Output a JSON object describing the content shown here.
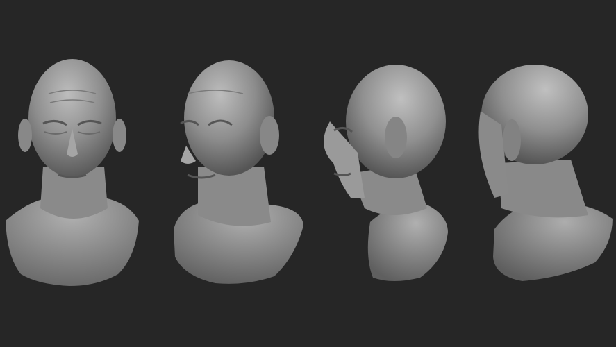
{
  "scene": {
    "background_color": "#262626",
    "material_color": "#9a9a9a",
    "views": [
      {
        "name": "front",
        "icon": "bust-front-view"
      },
      {
        "name": "three-quarter",
        "icon": "bust-three-quarter-view"
      },
      {
        "name": "profile",
        "icon": "bust-profile-view"
      },
      {
        "name": "back-three-quarter",
        "icon": "bust-back-view"
      }
    ]
  }
}
